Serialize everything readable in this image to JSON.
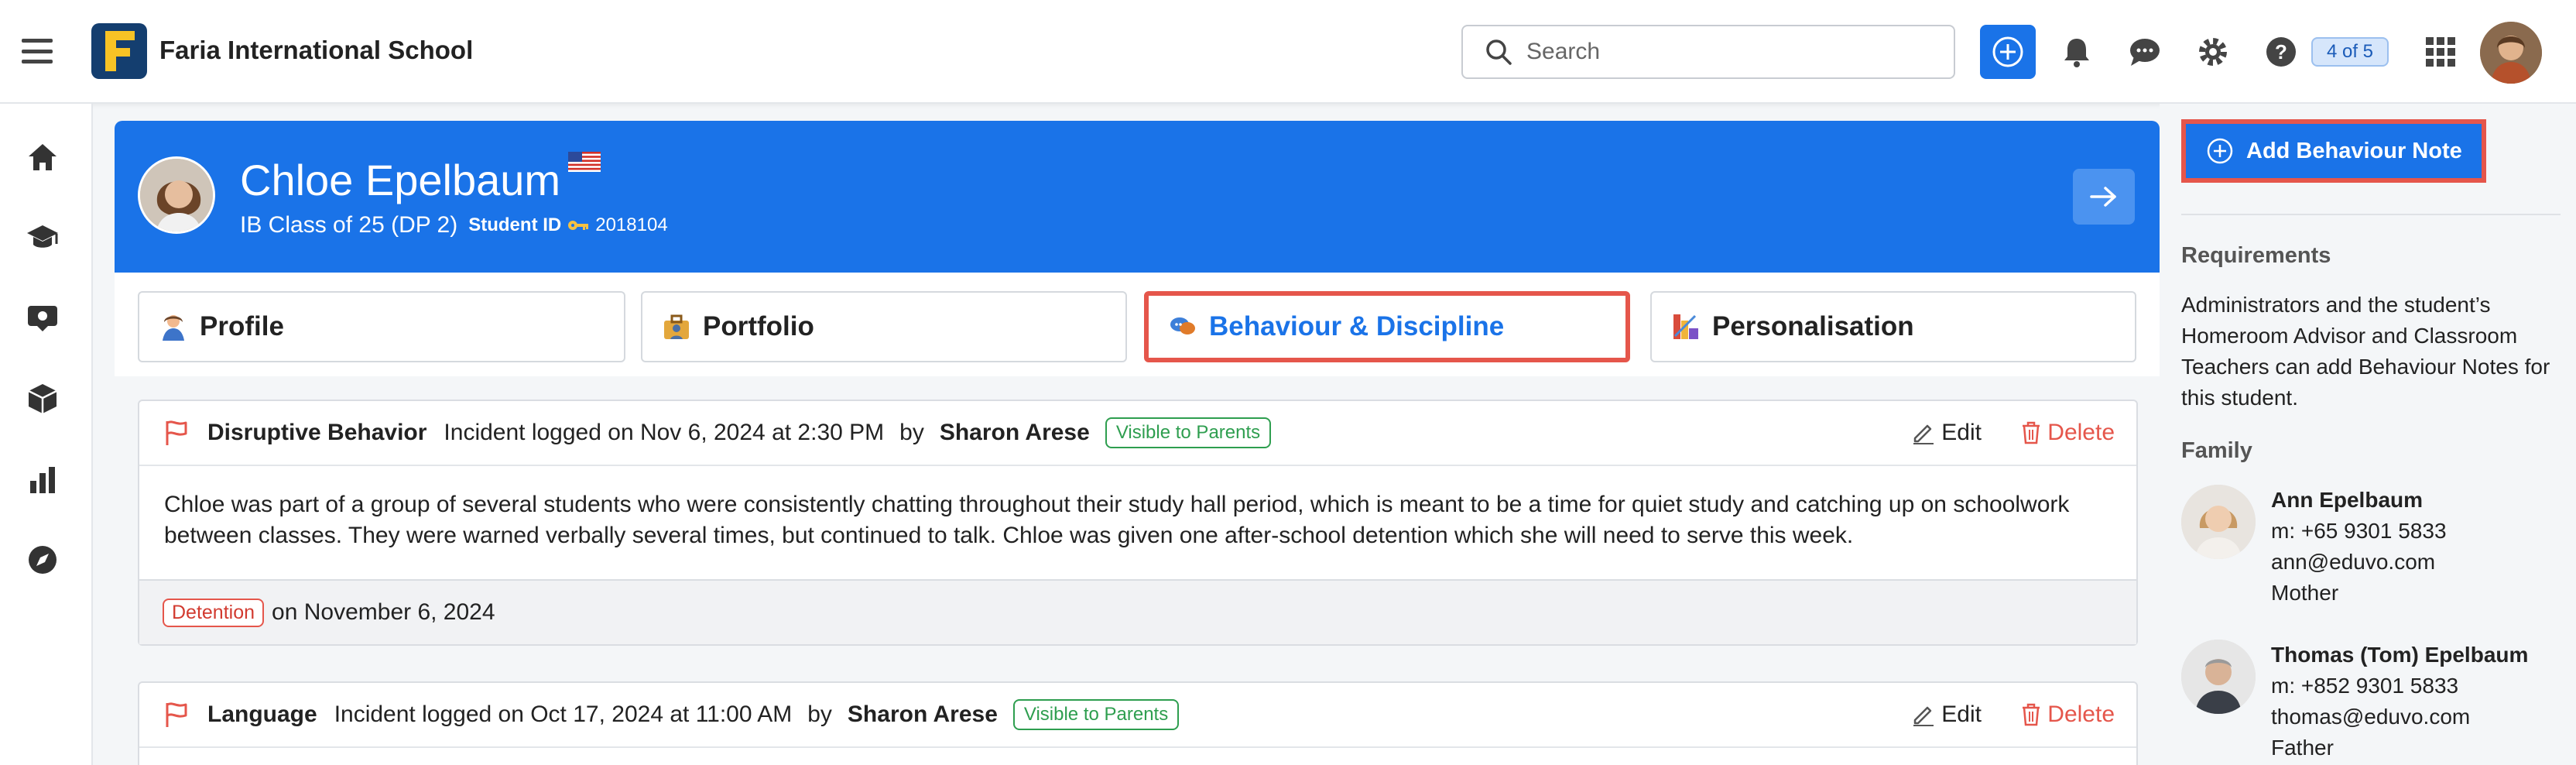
{
  "app": {
    "school_name": "Faria International School"
  },
  "search": {
    "placeholder": "Search"
  },
  "topbar": {
    "page_counter": "4 of 5"
  },
  "student": {
    "name": "Chloe Epelbaum",
    "class": "IB Class of 25 (DP 2)",
    "student_id_label": "Student ID",
    "student_id": "2018104"
  },
  "tabs": [
    {
      "label": "Profile"
    },
    {
      "label": "Portfolio"
    },
    {
      "label": "Behaviour & Discipline"
    },
    {
      "label": "Personalisation"
    }
  ],
  "incidents": [
    {
      "type": "Disruptive Behavior",
      "logged": "Incident logged on Nov 6, 2024 at 2:30 PM",
      "by": "by",
      "author": "Sharon Arese",
      "visibility": "Visible to Parents",
      "body_line1": "Chloe was part of a group of several students who were consistently chatting throughout their study hall period, which is meant to be a time for quiet study and catching up on schoolwork",
      "body_line2": "between classes. They were warned verbally several times, but continued to talk. Chloe was given one after-school detention which she will need to serve this week.",
      "action": "Detention",
      "action_date": "on November 6, 2024"
    },
    {
      "type": "Language",
      "logged": "Incident logged on Oct 17, 2024 at 11:00 AM",
      "by": "by",
      "author": "Sharon Arese",
      "visibility": "Visible to Parents"
    }
  ],
  "actions": {
    "edit": "Edit",
    "delete": "Delete"
  },
  "right_panel": {
    "add_button": "Add Behaviour Note",
    "requirements_heading": "Requirements",
    "requirements_line1": "Administrators and the student’s",
    "requirements_line2": "Homeroom Advisor and Classroom",
    "requirements_line3": "Teachers can add Behaviour Notes for",
    "requirements_line4": "this student.",
    "family_heading": "Family",
    "family": [
      {
        "name": "Ann Epelbaum",
        "phone": "m: +65 9301 5833",
        "email": "ann@eduvo.com",
        "relation": "Mother"
      },
      {
        "name": "Thomas (Tom) Epelbaum",
        "phone": "m: +852 9301 5833",
        "email": "thomas@eduvo.com",
        "relation": "Father"
      }
    ]
  },
  "colors": {
    "primary": "#1a73e8",
    "highlight": "#e5564b",
    "success": "#2e9e4f"
  }
}
